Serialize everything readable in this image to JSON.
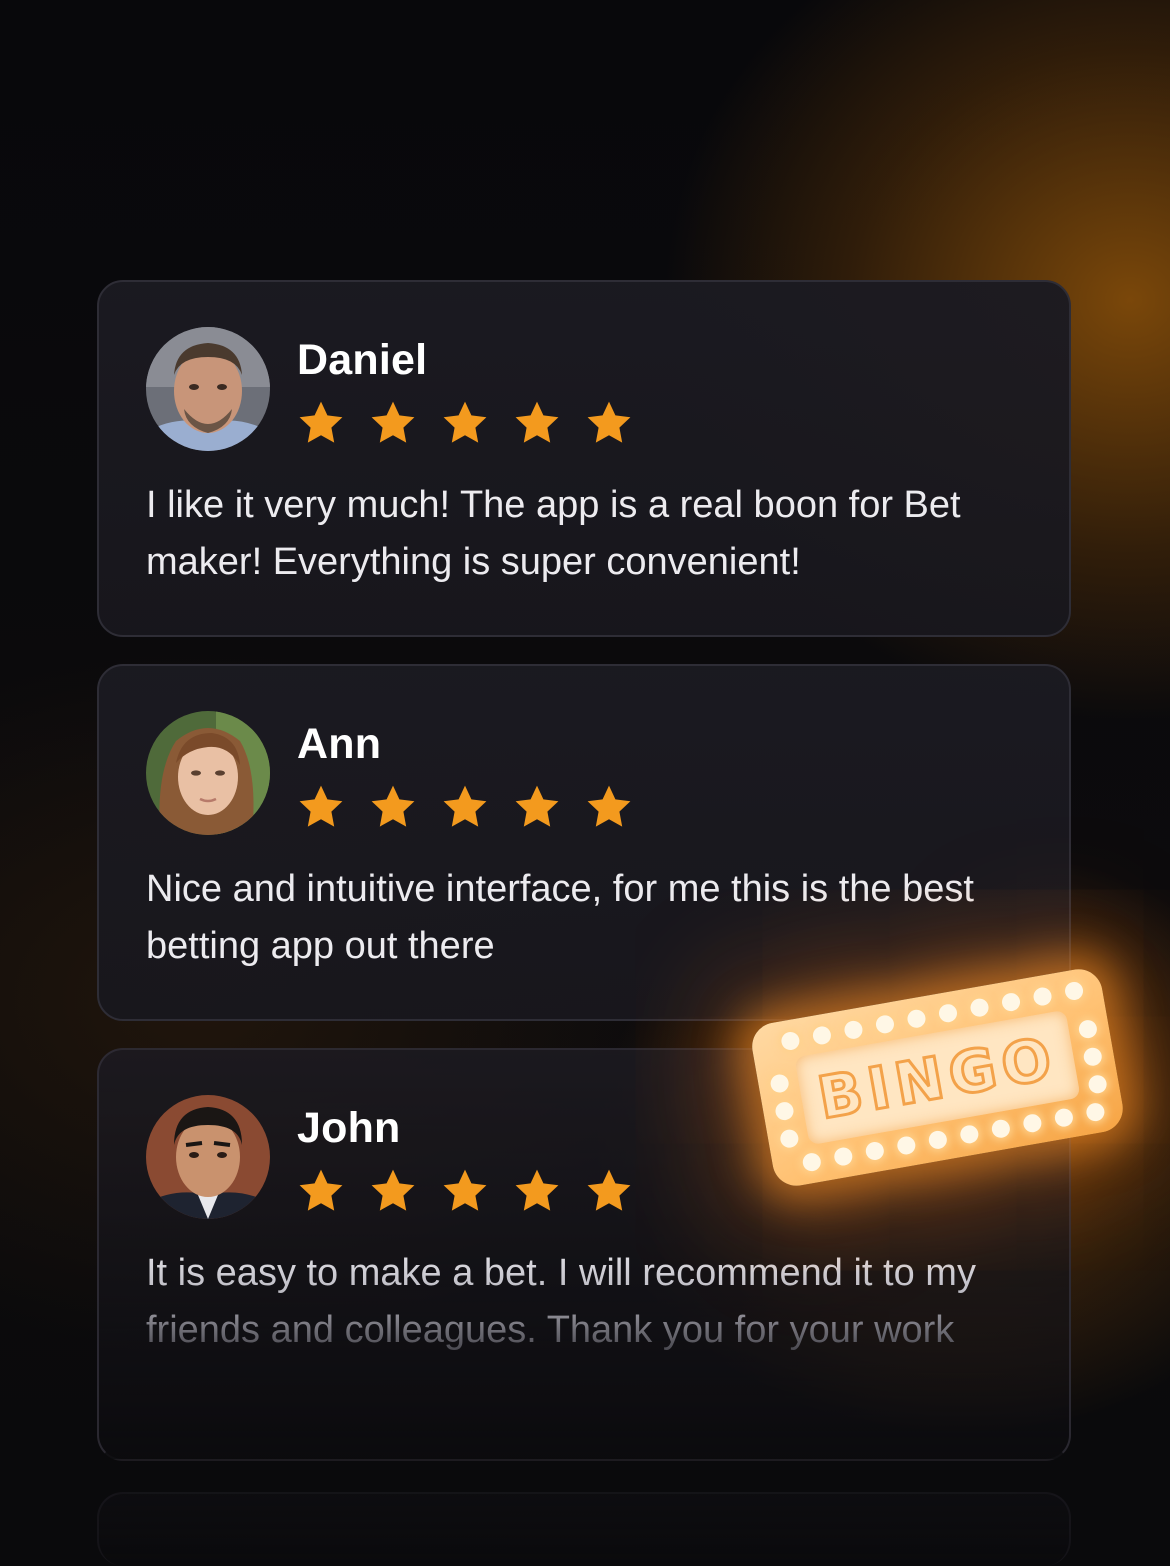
{
  "colors": {
    "star": "#F39A1E",
    "accent_glow": "#FF9A2A",
    "card_bg": "#1B1A21"
  },
  "reviews": [
    {
      "name": "Daniel",
      "rating": 5,
      "avatar_icon": "man-portrait",
      "text": "I like it very much! The app is a real boon for Bet maker! Everything is super convenient!"
    },
    {
      "name": "Ann",
      "rating": 5,
      "avatar_icon": "woman-portrait",
      "text": "Nice and intuitive interface, for me this is the best betting app out there"
    },
    {
      "name": "John",
      "rating": 5,
      "avatar_icon": "man-portrait",
      "text": "It is easy to make a bet. I will recommend it to my friends and colleagues. Thank you for your work"
    }
  ],
  "badge": {
    "label": "BINGO"
  }
}
